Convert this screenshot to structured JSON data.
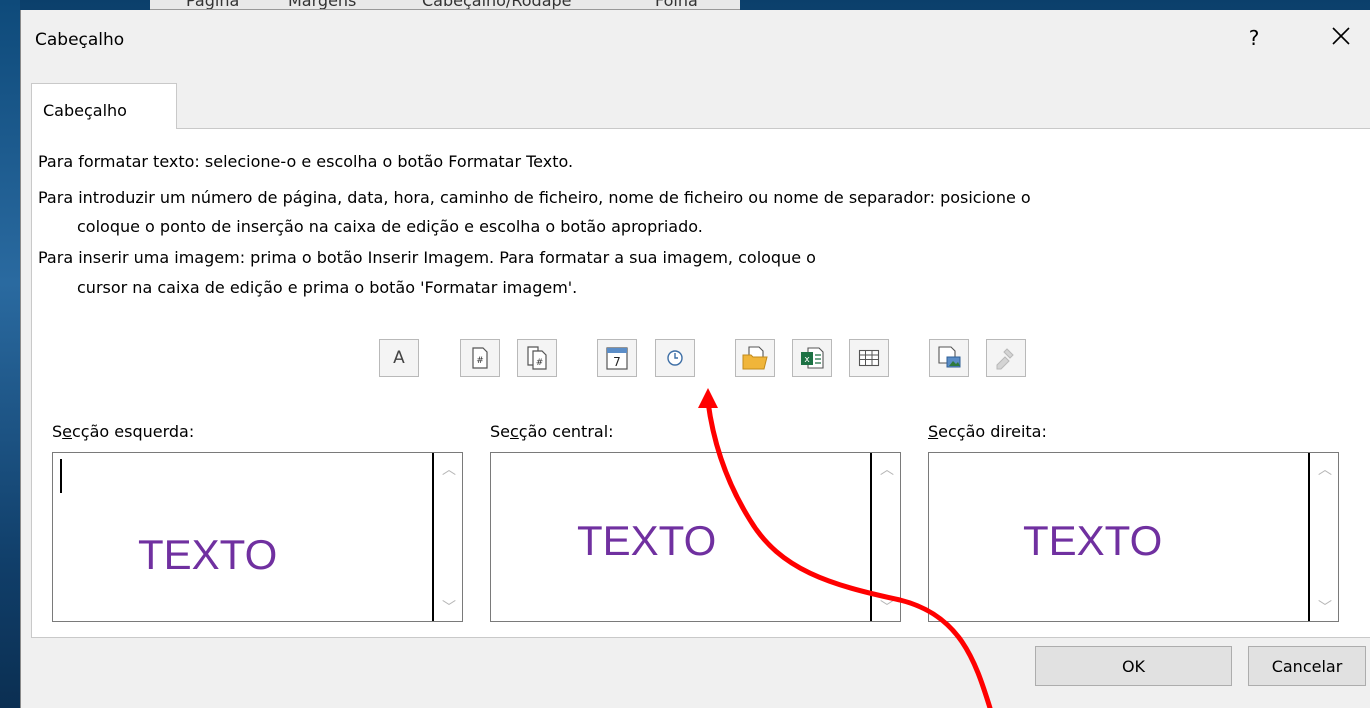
{
  "background_tabs": [
    "Página",
    "Margens",
    "Cabeçalho/Rodapé",
    "Folha"
  ],
  "dialog": {
    "title": "Cabeçalho",
    "help_label": "?",
    "tab_label": "Cabeçalho",
    "instructions": [
      "Para formatar texto: selecione-o e escolha o botão Formatar Texto.",
      "Para introduzir um número de página, data, hora, caminho de ficheiro, nome de ficheiro ou nome de separador: posicione o",
      "coloque o ponto de inserção na caixa de edição e escolha o botão apropriado.",
      "Para inserir uma imagem: prima o botão Inserir Imagem. Para formatar a sua imagem, coloque o",
      "cursor na caixa de edição e prima o botão 'Formatar imagem'."
    ],
    "toolbar": [
      {
        "icon": "format-text-icon",
        "glyph": "A"
      },
      {
        "icon": "page-number-icon"
      },
      {
        "icon": "number-of-pages-icon"
      },
      {
        "icon": "date-icon"
      },
      {
        "icon": "time-icon"
      },
      {
        "icon": "file-path-icon"
      },
      {
        "icon": "file-name-icon"
      },
      {
        "icon": "sheet-name-icon"
      },
      {
        "icon": "insert-picture-icon"
      },
      {
        "icon": "format-picture-icon"
      }
    ],
    "sections": {
      "left": {
        "label_pre": "S",
        "label_ul": "e",
        "label_post": "cção esquerda:",
        "text": "TEXTO"
      },
      "center": {
        "label_pre": "Se",
        "label_ul": "c",
        "label_post": "ção central:",
        "text": "TEXTO"
      },
      "right": {
        "label_pre": "",
        "label_ul": "S",
        "label_post": "ecção direita:",
        "text": "TEXTO"
      }
    },
    "buttons": {
      "ok": "OK",
      "cancel": "Cancelar"
    },
    "colors": {
      "section_text": "#7030a0",
      "annotation_arrow": "#ff0000"
    }
  }
}
